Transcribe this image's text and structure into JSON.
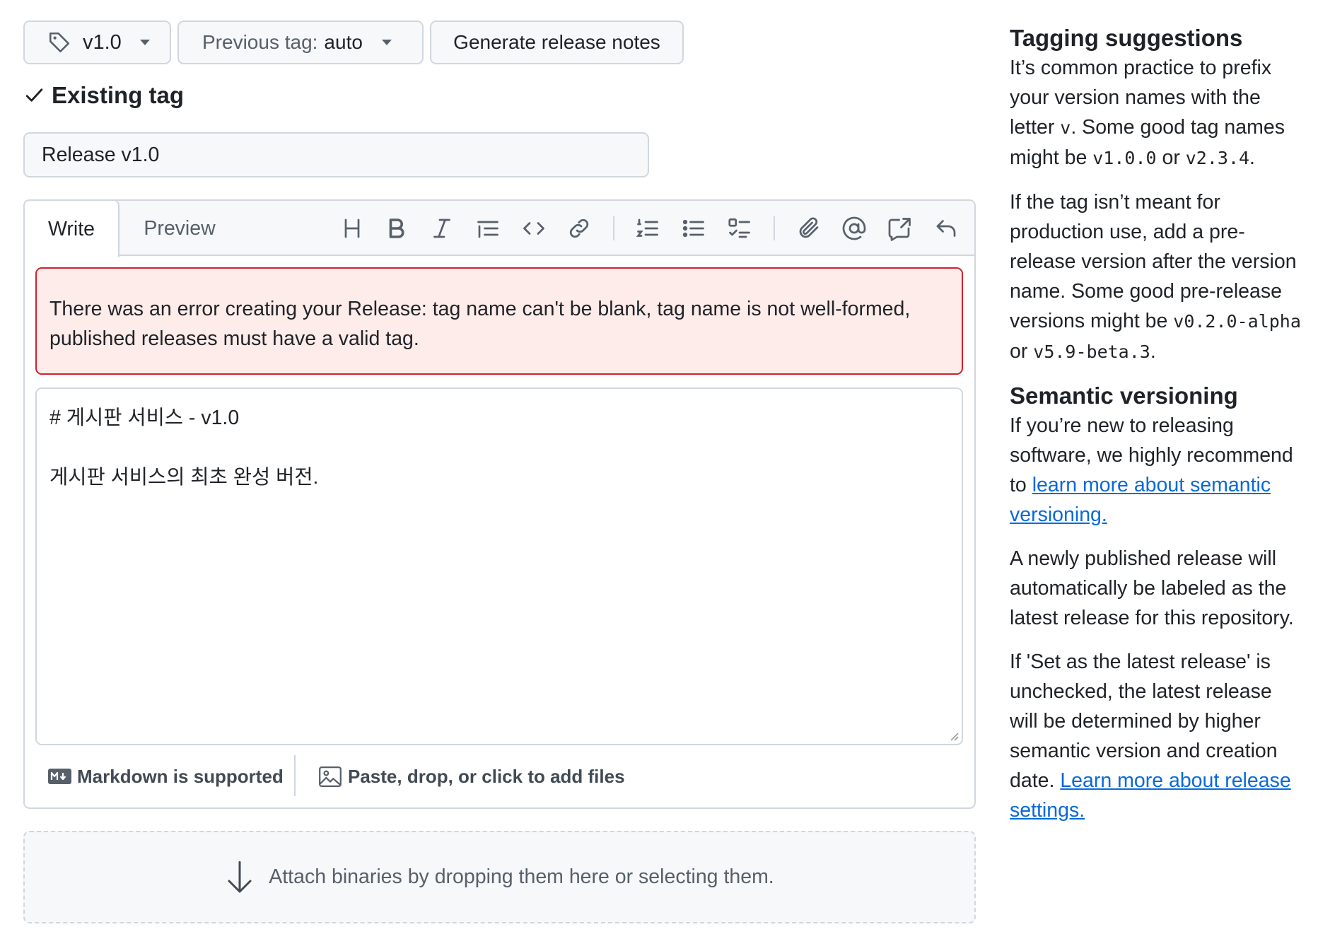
{
  "tag_picker": {
    "value": "v1.0"
  },
  "previous_tag": {
    "label": "Previous tag:",
    "value": "auto"
  },
  "generate_notes": {
    "label": "Generate release notes"
  },
  "existing_tag": {
    "label": "Existing tag"
  },
  "release_title": {
    "value": "Release v1.0"
  },
  "editor": {
    "tabs": {
      "write": "Write",
      "preview": "Preview"
    },
    "toolbar_icons": [
      "heading-icon",
      "bold-icon",
      "italic-icon",
      "quote-icon",
      "code-icon",
      "link-icon",
      "ordered-list-icon",
      "unordered-list-icon",
      "task-list-icon",
      "attach-icon",
      "mention-icon",
      "reference-icon",
      "undo-icon"
    ],
    "error_message": "There was an error creating your Release: tag name can't be blank, tag name is not well-formed, published releases must have a valid tag.",
    "body_line1": "# 게시판 서비스 - v1.0",
    "body_line2": "게시판 서비스의 최초 완성 버전.",
    "markdown_note": "Markdown is supported",
    "attach_files": "Paste, drop, or click to add files"
  },
  "binaries": {
    "label": "Attach binaries by dropping them here or selecting them."
  },
  "sidebar": {
    "tagging": {
      "title": "Tagging suggestions",
      "p1_a": "It’s common practice to prefix your version names with the letter ",
      "p1_code1": "v",
      "p1_b": ". Some good tag names might be ",
      "p1_code2": "v1.0.0",
      "p1_c": " or ",
      "p1_code3": "v2.3.4",
      "p1_d": ".",
      "p2_a": "If the tag isn’t meant for production use, add a pre-release version after the version name. Some good pre-release versions might be ",
      "p2_code1": "v0.2.0-alpha",
      "p2_b": " or ",
      "p2_code2": "v5.9-beta.3",
      "p2_c": "."
    },
    "semver": {
      "title": "Semantic versioning",
      "p1_a": "If you’re new to releasing software, we highly recommend to ",
      "p1_link": "learn more about semantic versioning.",
      "p2": "A newly published release will automatically be labeled as the latest release for this repository.",
      "p3_a": "If 'Set as the latest release' is unchecked, the latest release will be determined by higher semantic version and creation date. ",
      "p3_link": "Learn more about release settings."
    }
  },
  "colors": {
    "accent": "#0969da",
    "error_bg": "#fdecea",
    "error_border": "#cf222e",
    "muted": "#57606a"
  }
}
